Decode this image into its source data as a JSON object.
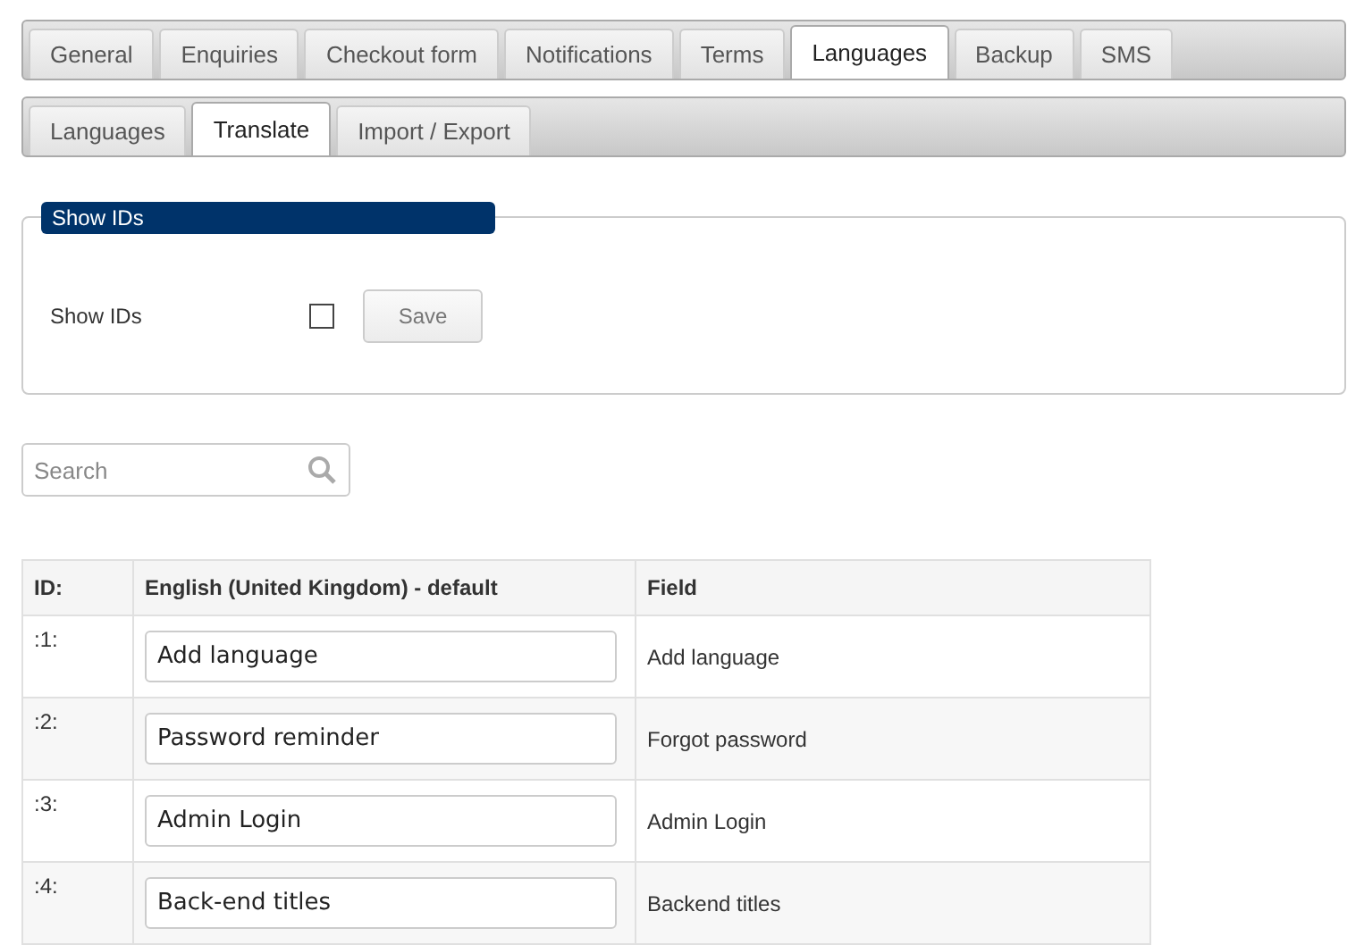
{
  "tabs": [
    {
      "label": "General",
      "selected": false
    },
    {
      "label": "Enquiries",
      "selected": false
    },
    {
      "label": "Checkout form",
      "selected": false
    },
    {
      "label": "Notifications",
      "selected": false
    },
    {
      "label": "Terms",
      "selected": false
    },
    {
      "label": "Languages",
      "selected": true
    },
    {
      "label": "Backup",
      "selected": false
    },
    {
      "label": "SMS",
      "selected": false
    }
  ],
  "subtabs": [
    {
      "label": "Languages",
      "selected": false
    },
    {
      "label": "Translate",
      "selected": true
    },
    {
      "label": "Import / Export",
      "selected": false
    }
  ],
  "show_ids": {
    "legend": "Show IDs",
    "label": "Show IDs",
    "checked": false,
    "button": "Save"
  },
  "search": {
    "placeholder": "Search"
  },
  "table": {
    "columns": [
      "ID:",
      "English (United Kingdom) - default",
      "Field"
    ],
    "rows": [
      {
        "id": ":1:",
        "value": "Add language",
        "field": "Add language"
      },
      {
        "id": ":2:",
        "value": "Password reminder",
        "field": "Forgot password"
      },
      {
        "id": ":3:",
        "value": "Admin Login",
        "field": "Admin Login"
      },
      {
        "id": ":4:",
        "value": "Back-end titles",
        "field": "Backend titles"
      }
    ]
  }
}
